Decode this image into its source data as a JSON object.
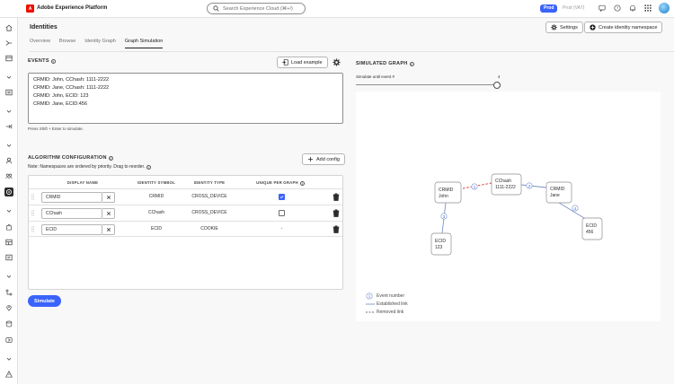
{
  "app": {
    "brand": "Adobe Experience Platform",
    "search_placeholder": "Search Experience Cloud (⌘+/)",
    "env_prod": "Prod",
    "env_alt": "Prod (VA7)"
  },
  "page": {
    "title": "Identities",
    "settings_label": "Settings",
    "create_label": "Create identity namespace",
    "tabs": [
      "Overview",
      "Browse",
      "Identity Graph",
      "Graph Simulation"
    ],
    "active_tab": "Graph Simulation"
  },
  "events": {
    "label": "EVENTS",
    "load_example": "Load example",
    "lines": [
      "CRMID: John, CChash: 1111-2222",
      "CRMID: Jane, CChash: 1111-2222",
      "CRMID: John, ECID: 123",
      "CRMID: Jane, ECID:456"
    ],
    "hint": "Press Shift + Enter to simulate."
  },
  "algorithm": {
    "label": "ALGORITHM CONFIGURATION",
    "add_config": "Add config",
    "note": "Note: Namespaces are ordered by priority. Drag to reorder.",
    "columns": {
      "display_name": "DISPLAY NAME",
      "identity_symbol": "IDENTITY SYMBOL",
      "identity_type": "IDENTITY TYPE",
      "unique": "UNIQUE PER GRAPH"
    },
    "rows": [
      {
        "display_name": "CRMID",
        "symbol": "CRMID",
        "type": "CROSS_DEVICE",
        "unique": "checked"
      },
      {
        "display_name": "CChash",
        "symbol": "CChash",
        "type": "CROSS_DEVICE",
        "unique": "unchecked"
      },
      {
        "display_name": "ECID",
        "symbol": "ECID",
        "type": "COOKIE",
        "unique": "-"
      }
    ],
    "simulate_label": "Simulate"
  },
  "simulated_graph": {
    "label": "SIMULATED GRAPH",
    "simulate_until_label": "Simulate until event #",
    "simulate_until_value": "4",
    "nodes": [
      {
        "id": "john",
        "ns": "CRMID",
        "val": "John"
      },
      {
        "id": "cc",
        "ns": "CChash",
        "val": "1111-2222"
      },
      {
        "id": "jane",
        "ns": "CRMID",
        "val": "Jane"
      },
      {
        "id": "ecid123",
        "ns": "ECID",
        "val": "123"
      },
      {
        "id": "ecid456",
        "ns": "ECID",
        "val": "456"
      }
    ],
    "edges": [
      {
        "from": "john",
        "to": "cc",
        "event": "1",
        "style": "removed"
      },
      {
        "from": "cc",
        "to": "jane",
        "event": "2",
        "style": "established"
      },
      {
        "from": "john",
        "to": "ecid123",
        "event": "3",
        "style": "established"
      },
      {
        "from": "jane",
        "to": "ecid456",
        "event": "4",
        "style": "established"
      }
    ],
    "legend": {
      "event_number_badge": "1",
      "event_number": "Event number",
      "established": "Established link",
      "removed": "Removed link"
    }
  },
  "colors": {
    "accent": "#3b63fb",
    "removed_link": "#d7373f",
    "established_link": "#7b93c8"
  }
}
